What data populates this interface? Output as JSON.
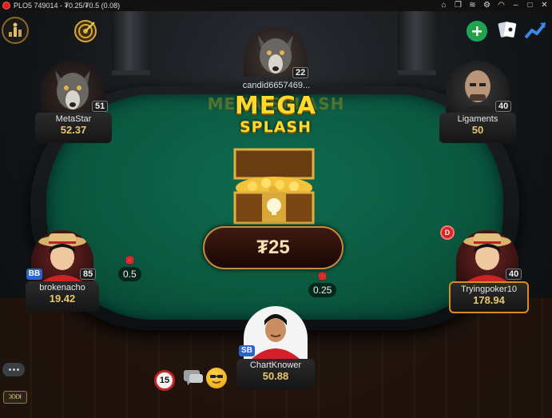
{
  "window": {
    "title": "PLO5 749014 - ₮0.25/₮0.5 (0.08)"
  },
  "felt_logo": "MEGA SPLASH",
  "mega_splash": {
    "line1": "MEGA",
    "line2": "SPLASH",
    "prize": "₮25"
  },
  "players": {
    "top": {
      "name": "candid6657469...",
      "level": "22"
    },
    "top_left": {
      "name": "MetaStar",
      "stack": "52.37",
      "level": "51"
    },
    "top_right": {
      "name": "Ligaments",
      "stack": "50",
      "level": "40"
    },
    "left": {
      "name": "brokenacho",
      "stack": "19.42",
      "level": "85",
      "position": "BB"
    },
    "right": {
      "name": "Tryingpoker10",
      "stack": "178.94",
      "level": "40"
    },
    "hero": {
      "name": "ChartKnower",
      "stack": "50.88",
      "position": "SB"
    }
  },
  "bets": {
    "left": "0.5",
    "hero": "0.25"
  },
  "dealer_button": "D",
  "timer": "15",
  "side_tag": "ꓘꓘꓘ",
  "colors": {
    "felt": "#0b5a41",
    "stack_gold": "#e9c86a",
    "title_gold": "#ffd92e",
    "position_badge": "#2a66c9"
  },
  "icons": [
    "home-icon",
    "copy-icon",
    "layers-icon",
    "gear-icon",
    "wifi-icon",
    "minimize-icon",
    "maximize-icon",
    "close-icon",
    "lobby-trophy-icon",
    "target-icon",
    "add-icon",
    "cards-icon",
    "stats-icon",
    "chat-icon",
    "emoji-icon"
  ]
}
